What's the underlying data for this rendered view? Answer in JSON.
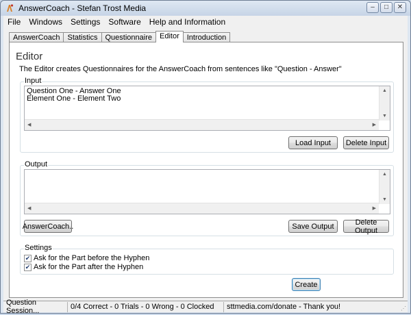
{
  "window": {
    "title": "AnswerCoach - Stefan Trost Media",
    "controls": {
      "minimize": "–",
      "maximize": "□",
      "close": "✕"
    }
  },
  "menu": [
    "File",
    "Windows",
    "Settings",
    "Software",
    "Help and Information"
  ],
  "tabs": [
    {
      "label": "AnswerCoach",
      "active": false
    },
    {
      "label": "Statistics",
      "active": false
    },
    {
      "label": "Questionnaire",
      "active": false
    },
    {
      "label": "Editor",
      "active": true
    },
    {
      "label": "Introduction",
      "active": false
    }
  ],
  "editor": {
    "title": "Editor",
    "description": "The Editor creates Questionnaires for the AnswerCoach from sentences like \"Question - Answer\"",
    "input": {
      "label": "Input",
      "lines": [
        "Question One - Answer One",
        "Element One - Element Two"
      ],
      "load_button": "Load Input",
      "delete_button": "Delete Input"
    },
    "output": {
      "label": "Output",
      "text": "",
      "answercoach_button": "AnswerCoach..",
      "save_button": "Save Output",
      "delete_button": "Delete Output"
    },
    "settings": {
      "label": "Settings",
      "options": [
        {
          "label": "Ask for the Part before the Hyphen",
          "checked": true
        },
        {
          "label": "Ask for the Part after the Hyphen",
          "checked": true
        }
      ]
    },
    "create_button": "Create"
  },
  "statusbar": {
    "session": "Question Session...",
    "stats": "0/4 Correct - 0 Trials - 0 Wrong - 0 Clocked",
    "donate": "sttmedia.com/donate - Thank you!"
  },
  "icons": {
    "scroll_up": "▲",
    "scroll_down": "▼",
    "scroll_left": "◀",
    "scroll_right": "▶",
    "check": "✔",
    "grip": "⋰"
  }
}
